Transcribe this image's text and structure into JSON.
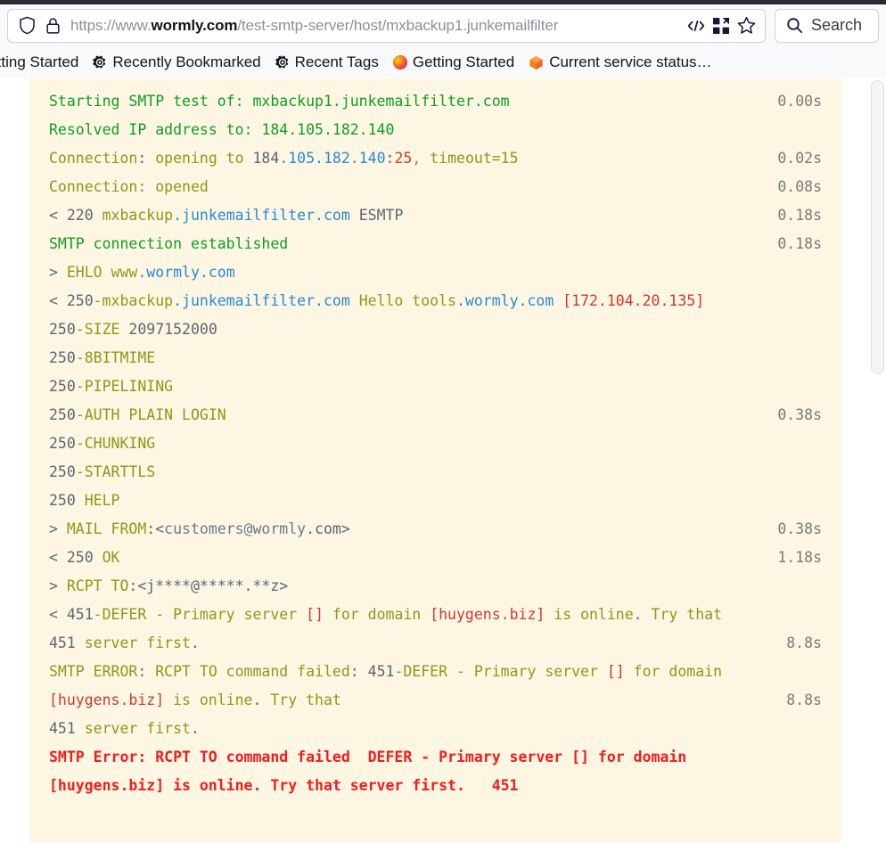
{
  "browser": {
    "url_prefix": "https://www.",
    "url_host": "wormly.com",
    "url_path": "/test-smtp-server/host/mxbackup1.junkemailfilter",
    "url_full": "https://www.wormly.com/test-smtp-server/host/mxbackup1.junkemailfilter",
    "search_placeholder": "Search",
    "bookmarks": [
      {
        "label": "Getting Started",
        "icon": "gear-icon"
      },
      {
        "label": "Recently Bookmarked",
        "icon": "gear-icon"
      },
      {
        "label": "Recent Tags",
        "icon": "gear-icon"
      },
      {
        "label": "Getting Started",
        "icon": "firefox-icon"
      },
      {
        "label": "Current service status…",
        "icon": "cube-icon"
      }
    ],
    "toolbar_icons": [
      "shield-icon",
      "lock-icon",
      "reader-code-icon",
      "extensions-icon",
      "bookmark-star-icon",
      "search-icon"
    ]
  },
  "console": {
    "lines": [
      {
        "id": "l1",
        "text": "Starting SMTP test of: mxbackup1.junkemailfilter.com",
        "time": "0.00s"
      },
      {
        "id": "l2",
        "text": "Resolved IP address to: 184.105.182.140",
        "time": ""
      },
      {
        "id": "l3",
        "text": "Connection: opening to 184.105.182.140:25, timeout=15",
        "time": "0.02s"
      },
      {
        "id": "l4",
        "text": "Connection: opened",
        "time": "0.08s"
      },
      {
        "id": "l5",
        "text": "< 220 mxbackup.junkemailfilter.com ESMTP",
        "time": "0.18s"
      },
      {
        "id": "l6",
        "text": "SMTP connection established",
        "time": "0.18s"
      },
      {
        "id": "l7",
        "text": "> EHLO www.wormly.com",
        "time": ""
      },
      {
        "id": "l8",
        "text": "< 250-mxbackup.junkemailfilter.com Hello tools.wormly.com [172.104.20.135]",
        "time": ""
      },
      {
        "id": "l9",
        "text": "250-SIZE 2097152000",
        "time": ""
      },
      {
        "id": "l10",
        "text": "250-8BITMIME",
        "time": ""
      },
      {
        "id": "l11",
        "text": "250-PIPELINING",
        "time": ""
      },
      {
        "id": "l12",
        "text": "250-AUTH PLAIN LOGIN",
        "time": "0.38s"
      },
      {
        "id": "l13",
        "text": "250-CHUNKING",
        "time": ""
      },
      {
        "id": "l14",
        "text": "250-STARTTLS",
        "time": ""
      },
      {
        "id": "l15",
        "text": "250 HELP",
        "time": ""
      },
      {
        "id": "l16",
        "text": "> MAIL FROM:<customers@wormly.com>",
        "time": "0.38s"
      },
      {
        "id": "l17",
        "text": "< 250 OK",
        "time": "1.18s"
      },
      {
        "id": "l18",
        "text": "> RCPT TO:<j****@*****.**z>",
        "time": ""
      },
      {
        "id": "l19",
        "text": "< 451-DEFER - Primary server [] for domain [huygens.biz] is online. Try that",
        "time": "8.8s"
      },
      {
        "id": "l20",
        "text": "451 server first.",
        "time": ""
      },
      {
        "id": "l21",
        "text": "SMTP ERROR: RCPT TO command failed: 451-DEFER - Primary server [] for domain [huygens.biz] is online. Try that",
        "time": "8.8s"
      },
      {
        "id": "l22",
        "text": "451 server first.",
        "time": ""
      },
      {
        "id": "l23",
        "text": "SMTP Error: RCPT TO command failed  DEFER - Primary server [] for domain [huygens.biz] is online. Try that server first.   451",
        "time": ""
      }
    ]
  },
  "colors": {
    "console_bg": "#fdf6e3",
    "green": "#0f9d22",
    "olive": "#8a9a1a",
    "blue": "#268bd2",
    "red": "#cb3a30",
    "error": "#f01d1d",
    "gray": "#5c6670",
    "chrome_bg": "#f9f9fb"
  }
}
